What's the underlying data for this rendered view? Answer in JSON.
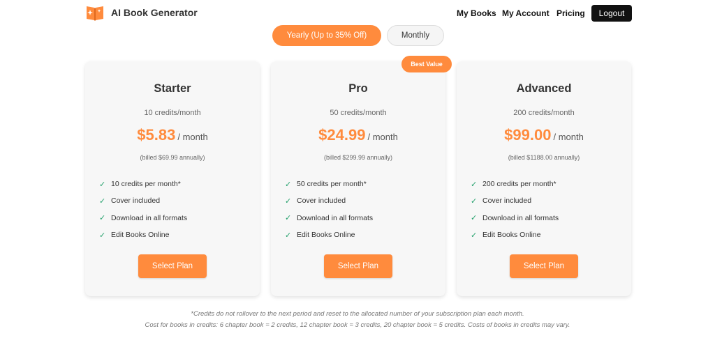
{
  "header": {
    "brand": "AI Book Generator",
    "nav": {
      "my_books": "My Books",
      "my_account": "My Account",
      "pricing": "Pricing",
      "logout": "Logout"
    }
  },
  "billing_toggle": {
    "yearly": "Yearly (Up to 35% Off)",
    "monthly": "Monthly",
    "selected": "Yearly (Up to 35% Off)"
  },
  "badge": "Best Value",
  "plans": [
    {
      "name": "Starter",
      "credits": "10 credits/month",
      "price": "$5.83",
      "per": "/ month",
      "billed": "(billed $69.99 annually)",
      "features": [
        "10 credits per month*",
        "Cover included",
        "Download in all formats",
        "Edit Books Online"
      ],
      "button": "Select Plan"
    },
    {
      "name": "Pro",
      "credits": "50 credits/month",
      "price": "$24.99",
      "per": "/ month",
      "billed": "(billed $299.99 annually)",
      "features": [
        "50 credits per month*",
        "Cover included",
        "Download in all formats",
        "Edit Books Online"
      ],
      "button": "Select Plan"
    },
    {
      "name": "Advanced",
      "credits": "200 credits/month",
      "price": "$99.00",
      "per": "/ month",
      "billed": "(billed $1188.00 annually)",
      "features": [
        "200 credits per month*",
        "Cover included",
        "Download in all formats",
        "Edit Books Online"
      ],
      "button": "Select Plan"
    }
  ],
  "check_icon": "✓",
  "footnotes": [
    "*Credits do not rollover to the next period and reset to the allocated number of your subscription plan each month.",
    "Cost for books in credits: 6 chapter book = 2 credits, 12 chapter book = 3 credits, 20 chapter book = 5 credits. Costs of books in credits may vary."
  ],
  "colors": {
    "accent": "#ff8b3d",
    "check": "#22a06b",
    "dark": "#111111",
    "card": "#f7f7f7"
  }
}
